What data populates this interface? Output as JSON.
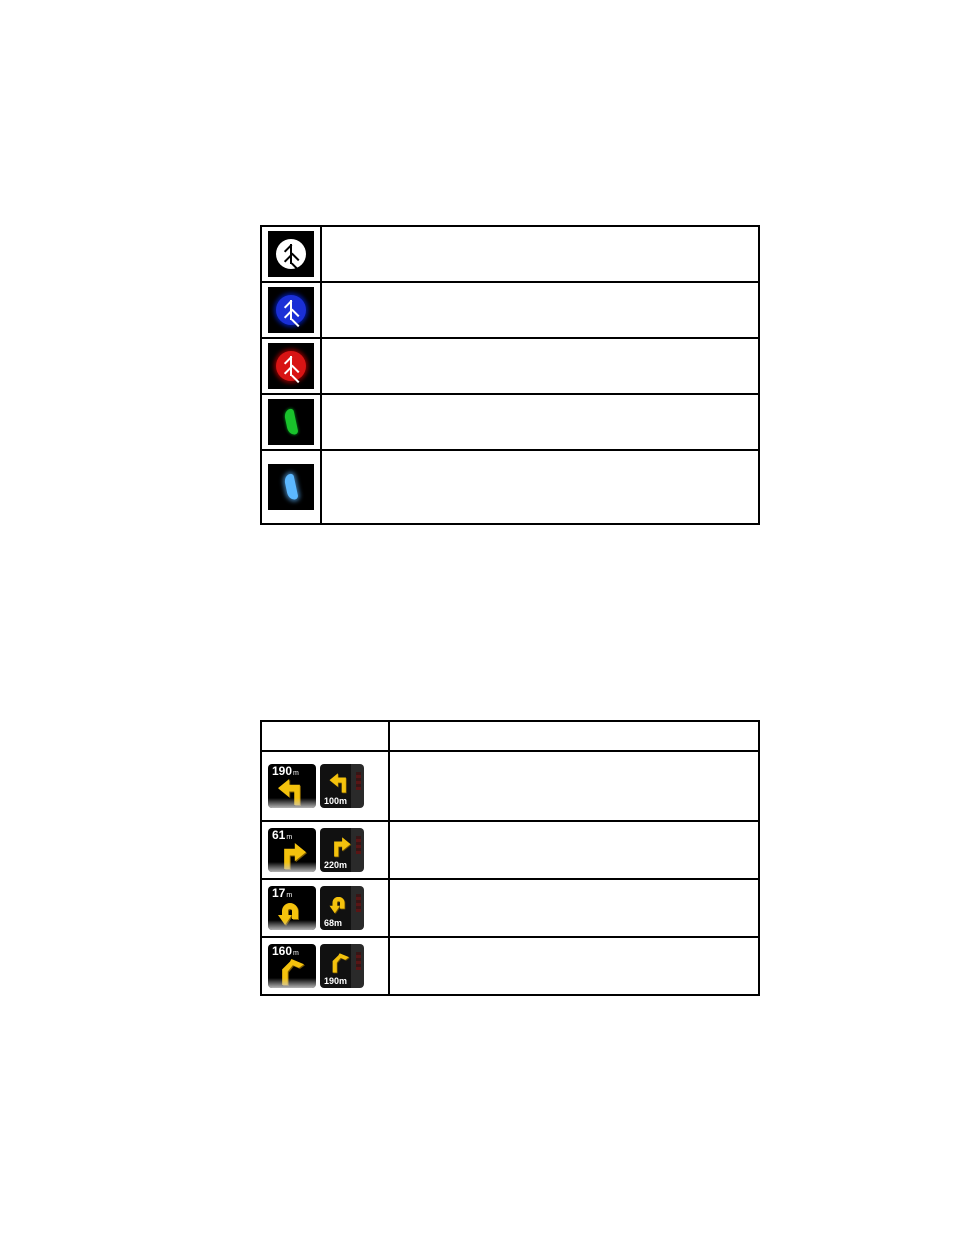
{
  "table1": {
    "rows": [
      {
        "icon": "bluetooth-white",
        "desc": ""
      },
      {
        "icon": "bluetooth-blue",
        "desc": ""
      },
      {
        "icon": "bluetooth-red",
        "desc": ""
      },
      {
        "icon": "phone-green",
        "desc": ""
      },
      {
        "icon": "phone-blue",
        "desc": ""
      }
    ]
  },
  "table2": {
    "headers": {
      "picture": "",
      "description": ""
    },
    "rows": [
      {
        "arrow": "left",
        "big_dist": "190",
        "big_unit": "m",
        "sm_dist": "100m",
        "desc": ""
      },
      {
        "arrow": "right",
        "big_dist": "61",
        "big_unit": "m",
        "sm_dist": "220m",
        "desc": ""
      },
      {
        "arrow": "uturn",
        "big_dist": "17",
        "big_unit": "m",
        "sm_dist": "68m",
        "desc": ""
      },
      {
        "arrow": "slight-right",
        "big_dist": "160",
        "big_unit": "m",
        "sm_dist": "190m",
        "desc": ""
      }
    ]
  }
}
